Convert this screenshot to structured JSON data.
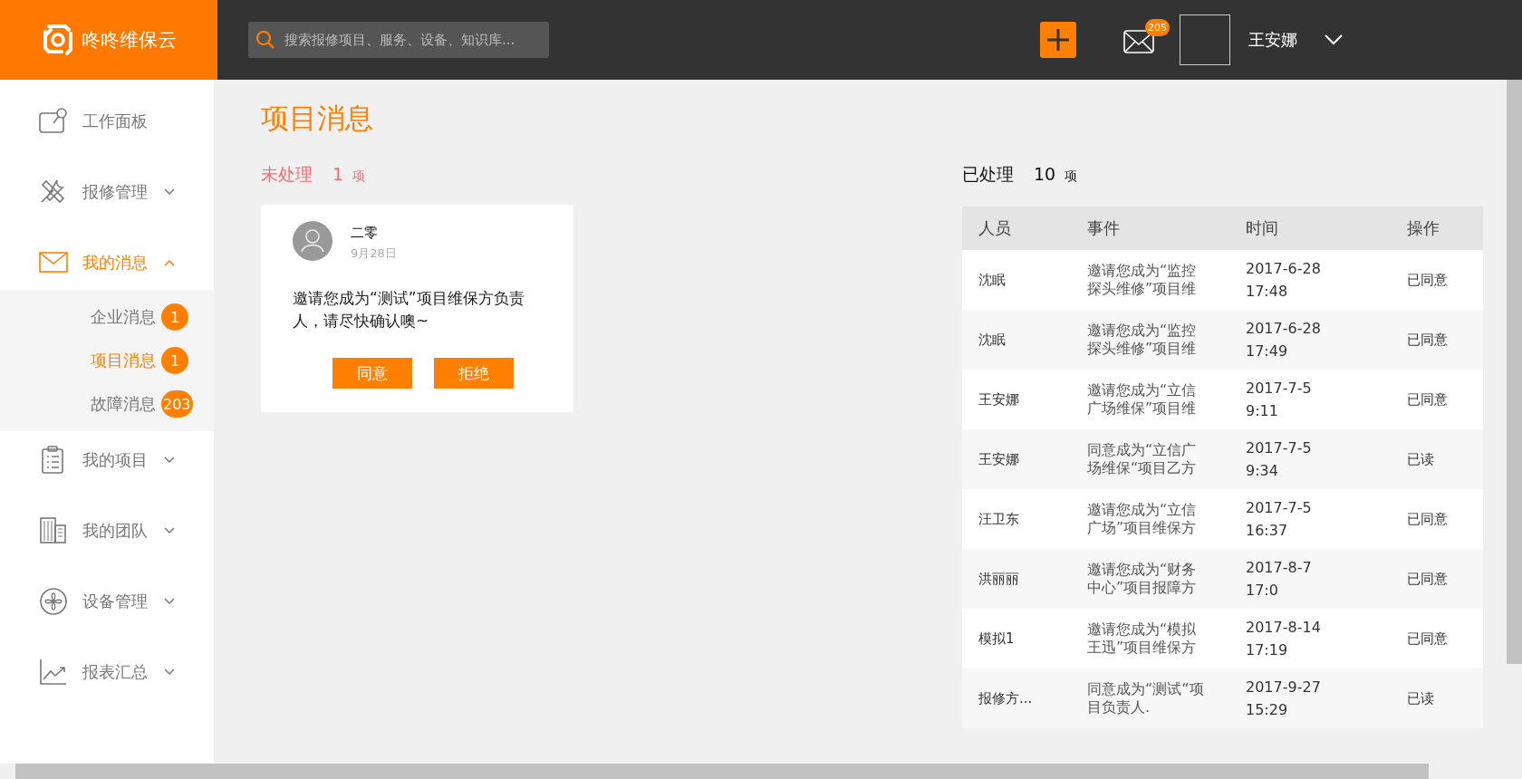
{
  "header": {
    "brand": "咚咚维保云",
    "search": {
      "placeholder": "搜索报修项目、服务、设备、知识库..."
    },
    "mail_badge": "205",
    "user_name": "王安娜"
  },
  "sidebar": {
    "items": [
      {
        "label": "工作面板",
        "kind": "link",
        "selected": false
      },
      {
        "label": "报修管理",
        "kind": "group",
        "selected": false,
        "expanded": false
      },
      {
        "label": "我的消息",
        "kind": "group",
        "selected": true,
        "expanded": true,
        "children": [
          {
            "label": "企业消息",
            "badge": "1",
            "selected": false
          },
          {
            "label": "项目消息",
            "badge": "1",
            "selected": true
          },
          {
            "label": "故障消息",
            "badge": "203",
            "selected": false
          }
        ]
      },
      {
        "label": "我的项目",
        "kind": "group",
        "selected": false,
        "expanded": false
      },
      {
        "label": "我的团队",
        "kind": "group",
        "selected": false,
        "expanded": false
      },
      {
        "label": "设备管理",
        "kind": "group",
        "selected": false,
        "expanded": false
      },
      {
        "label": "报表汇总",
        "kind": "group",
        "selected": false,
        "expanded": false
      }
    ]
  },
  "page_title": "项目消息",
  "pending": {
    "label": "未处理",
    "count": "1",
    "unit": "项",
    "cards": [
      {
        "name": "二零",
        "date": "9月28日",
        "message": "邀请您成为“测试”项目维保方负责人，请尽快确认噢~",
        "buttons": [
          "同意",
          "拒绝"
        ]
      }
    ]
  },
  "processed": {
    "label": "已处理",
    "count": "10",
    "unit": "项",
    "table": {
      "columns": [
        "人员",
        "事件",
        "时间",
        "操作"
      ],
      "rows": [
        {
          "person": "沈眠",
          "event": "邀请您成为“监控探头维修”项目维",
          "date": "2017-6-28",
          "time": "17:48",
          "action": "已同意"
        },
        {
          "person": "沈眠",
          "event": "邀请您成为“监控探头维修”项目维",
          "date": "2017-6-28",
          "time": "17:49",
          "action": "已同意"
        },
        {
          "person": "王安娜",
          "event": "邀请您成为“立信广场维保”项目维",
          "date": "2017-7-5",
          "time": "9:11",
          "action": "已同意"
        },
        {
          "person": "王安娜",
          "event": "同意成为“立信广场维保“项目乙方",
          "date": "2017-7-5",
          "time": "9:34",
          "action": "已读"
        },
        {
          "person": "汪卫东",
          "event": "邀请您成为“立信广场”项目维保方",
          "date": "2017-7-5",
          "time": "16:37",
          "action": "已同意"
        },
        {
          "person": "洪丽丽",
          "event": "邀请您成为“财务中心”项目报障方",
          "date": "2017-8-7",
          "time": "17:0",
          "action": "已同意"
        },
        {
          "person": "模拟1",
          "event": "邀请您成为“模拟王迅”项目维保方",
          "date": "2017-8-14",
          "time": "17:19",
          "action": "已同意"
        },
        {
          "person": "报修方...",
          "event": "同意成为“测试“项目负责人.",
          "date": "2017-9-27",
          "time": "15:29",
          "action": "已读"
        }
      ]
    }
  }
}
